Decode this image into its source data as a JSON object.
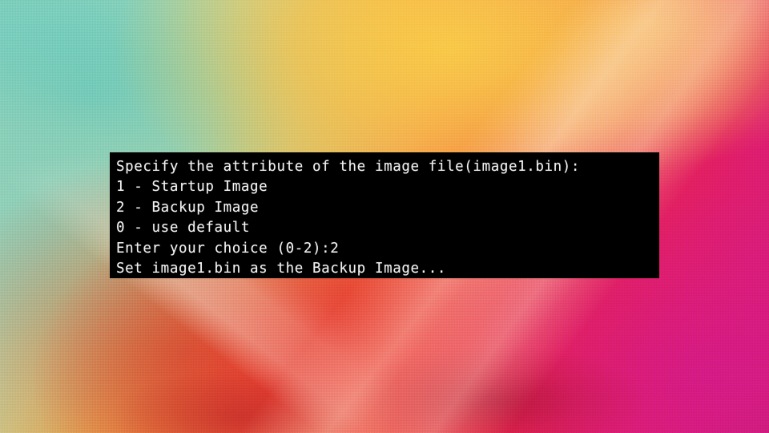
{
  "background": {
    "description": "abstract watercolor canvas painting",
    "colors": {
      "teal": "#62c8ba",
      "yellow": "#fac646",
      "orange": "#f4723f",
      "red": "#ec2024",
      "magenta": "#d61886",
      "peach": "#fae6d6"
    }
  },
  "console": {
    "background_color": "#000000",
    "text_color": "#f2f2f2",
    "lines": [
      "Specify the attribute of the image file(image1.bin):",
      "1 - Startup Image",
      "2 - Backup Image",
      "0 - use default",
      "Enter your choice (0-2):2",
      "Set image1.bin as the Backup Image..."
    ],
    "prompt": {
      "question": "Enter your choice (0-2):",
      "entered_value": "2",
      "range": "0-2"
    },
    "file_name": "image1.bin",
    "options": [
      {
        "key": "1",
        "label": "Startup Image"
      },
      {
        "key": "2",
        "label": "Backup Image"
      },
      {
        "key": "0",
        "label": "use default"
      }
    ],
    "result": "Set image1.bin as the Backup Image..."
  }
}
